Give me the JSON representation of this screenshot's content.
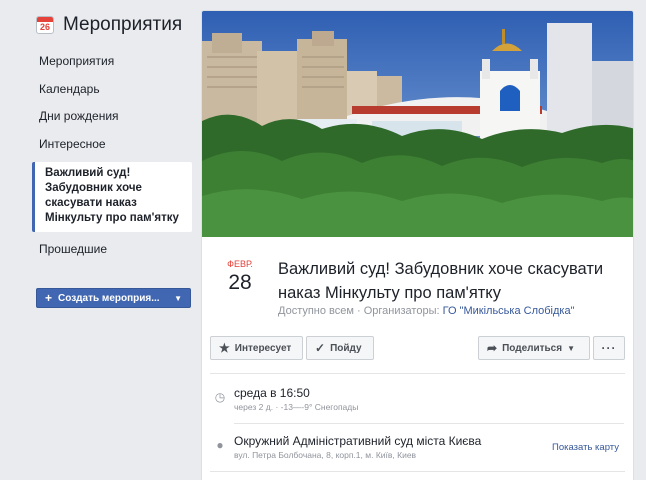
{
  "sidebar": {
    "icon_number": "26",
    "title": "Мероприятия",
    "items": [
      {
        "label": "Мероприятия"
      },
      {
        "label": "Календарь"
      },
      {
        "label": "Дни рождения"
      },
      {
        "label": "Интересное"
      }
    ],
    "selected_event": "Важливий суд! Забудовник хоче скасувати наказ Мінкульту про пам'ятку",
    "past_label": "Прошедшие",
    "create_button": "Создать мероприя..."
  },
  "event": {
    "month": "ФЕВР.",
    "day": "28",
    "title": "Важливий суд! Забудовник хоче скасувати наказ Мінкульту про пам'ятку",
    "meta_prefix": "Доступно всем · Организаторы: ",
    "organizer": "ГО \"Микільська Слобідка\""
  },
  "actions": {
    "interested": "Интересует",
    "going": "Пойду",
    "share": "Поделиться",
    "more": "···"
  },
  "details": {
    "time_primary": "среда в 16:50",
    "time_secondary": "через 2 д. · -13—-9° Снегопады",
    "place_primary": "Окружний Адміністративний суд міста Києва",
    "place_secondary": "вул. Петра Болбочана, 8, корп.1, м. Київ, Киев",
    "map_link": "Показать карту"
  },
  "colors": {
    "brand": "#4267b2",
    "accent_red": "#e5423a",
    "link": "#365899"
  }
}
